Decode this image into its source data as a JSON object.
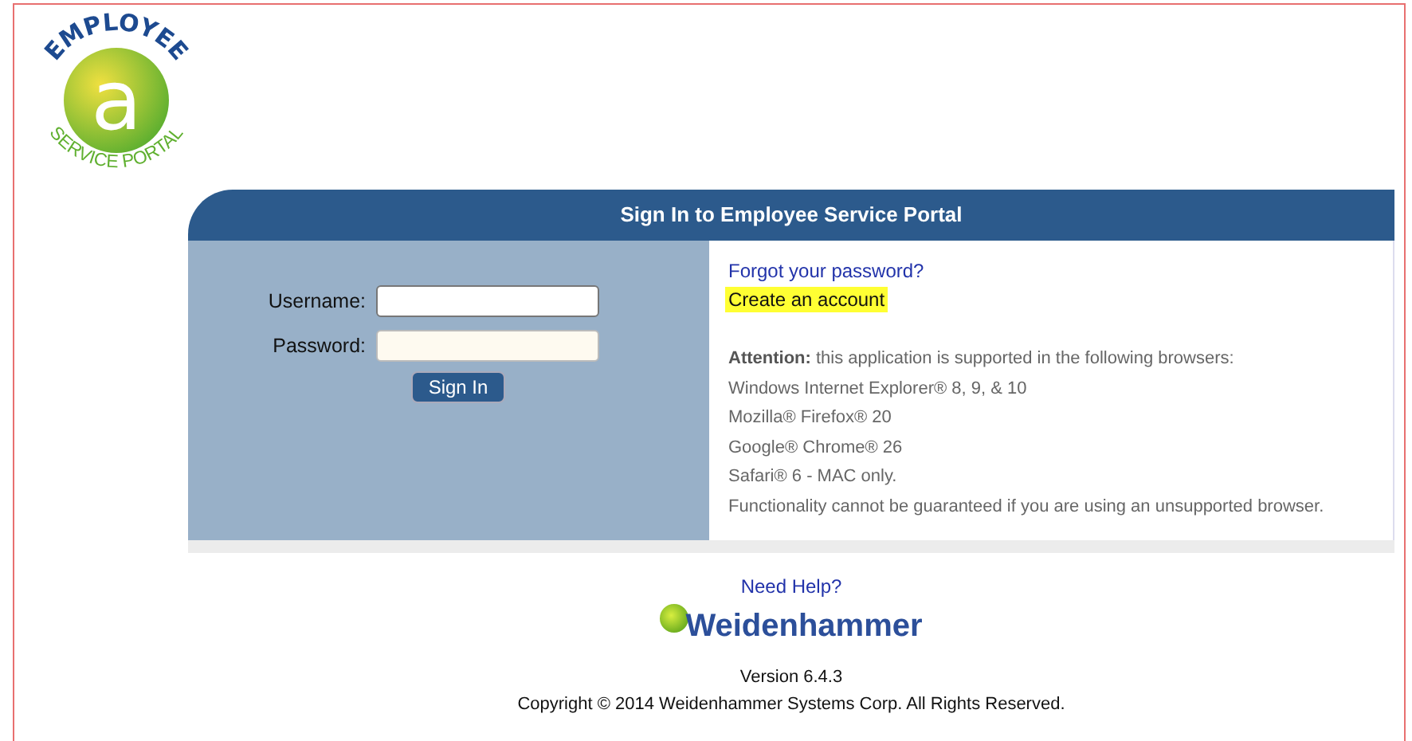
{
  "logo": {
    "top_text": "EMPLOYEE",
    "letter": "a",
    "bottom_text": "SERVICE PORTAL"
  },
  "panel": {
    "title": "Sign In to Employee Service Portal"
  },
  "form": {
    "fields": [
      {
        "label": "Username:",
        "kind": "text"
      },
      {
        "label": "Password:",
        "kind": "password"
      }
    ],
    "button": "Sign In"
  },
  "links": [
    {
      "text": "Forgot your password?",
      "highlighted": false
    },
    {
      "text": "Create an account",
      "highlighted": true
    }
  ],
  "notice": {
    "lines": [
      "**Attention:** this application is supported in the following browsers:",
      "Windows Internet Explorer® 8, 9, & 10",
      "Mozilla® Firefox® 20",
      "Google® Chrome® 26",
      "Safari® 6 - MAC only.",
      "Functionality cannot be guaranteed if you are using an unsupported browser."
    ]
  },
  "footer": {
    "help_link": "Need Help?",
    "brand": "Weidenhammer",
    "version": "Version 6.4.3",
    "copyright": "Copyright © 2014 Weidenhammer Systems Corp. All Rights Reserved."
  }
}
